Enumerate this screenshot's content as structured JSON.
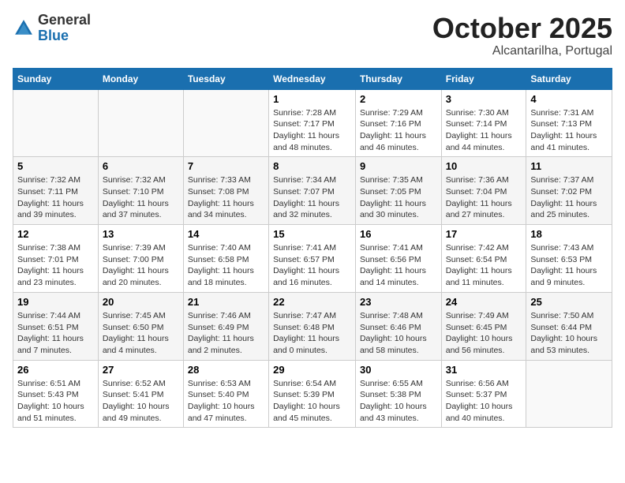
{
  "header": {
    "logo_general": "General",
    "logo_blue": "Blue",
    "month": "October 2025",
    "location": "Alcantarilha, Portugal"
  },
  "weekdays": [
    "Sunday",
    "Monday",
    "Tuesday",
    "Wednesday",
    "Thursday",
    "Friday",
    "Saturday"
  ],
  "weeks": [
    [
      {
        "day": "",
        "info": ""
      },
      {
        "day": "",
        "info": ""
      },
      {
        "day": "",
        "info": ""
      },
      {
        "day": "1",
        "info": "Sunrise: 7:28 AM\nSunset: 7:17 PM\nDaylight: 11 hours\nand 48 minutes."
      },
      {
        "day": "2",
        "info": "Sunrise: 7:29 AM\nSunset: 7:16 PM\nDaylight: 11 hours\nand 46 minutes."
      },
      {
        "day": "3",
        "info": "Sunrise: 7:30 AM\nSunset: 7:14 PM\nDaylight: 11 hours\nand 44 minutes."
      },
      {
        "day": "4",
        "info": "Sunrise: 7:31 AM\nSunset: 7:13 PM\nDaylight: 11 hours\nand 41 minutes."
      }
    ],
    [
      {
        "day": "5",
        "info": "Sunrise: 7:32 AM\nSunset: 7:11 PM\nDaylight: 11 hours\nand 39 minutes."
      },
      {
        "day": "6",
        "info": "Sunrise: 7:32 AM\nSunset: 7:10 PM\nDaylight: 11 hours\nand 37 minutes."
      },
      {
        "day": "7",
        "info": "Sunrise: 7:33 AM\nSunset: 7:08 PM\nDaylight: 11 hours\nand 34 minutes."
      },
      {
        "day": "8",
        "info": "Sunrise: 7:34 AM\nSunset: 7:07 PM\nDaylight: 11 hours\nand 32 minutes."
      },
      {
        "day": "9",
        "info": "Sunrise: 7:35 AM\nSunset: 7:05 PM\nDaylight: 11 hours\nand 30 minutes."
      },
      {
        "day": "10",
        "info": "Sunrise: 7:36 AM\nSunset: 7:04 PM\nDaylight: 11 hours\nand 27 minutes."
      },
      {
        "day": "11",
        "info": "Sunrise: 7:37 AM\nSunset: 7:02 PM\nDaylight: 11 hours\nand 25 minutes."
      }
    ],
    [
      {
        "day": "12",
        "info": "Sunrise: 7:38 AM\nSunset: 7:01 PM\nDaylight: 11 hours\nand 23 minutes."
      },
      {
        "day": "13",
        "info": "Sunrise: 7:39 AM\nSunset: 7:00 PM\nDaylight: 11 hours\nand 20 minutes."
      },
      {
        "day": "14",
        "info": "Sunrise: 7:40 AM\nSunset: 6:58 PM\nDaylight: 11 hours\nand 18 minutes."
      },
      {
        "day": "15",
        "info": "Sunrise: 7:41 AM\nSunset: 6:57 PM\nDaylight: 11 hours\nand 16 minutes."
      },
      {
        "day": "16",
        "info": "Sunrise: 7:41 AM\nSunset: 6:56 PM\nDaylight: 11 hours\nand 14 minutes."
      },
      {
        "day": "17",
        "info": "Sunrise: 7:42 AM\nSunset: 6:54 PM\nDaylight: 11 hours\nand 11 minutes."
      },
      {
        "day": "18",
        "info": "Sunrise: 7:43 AM\nSunset: 6:53 PM\nDaylight: 11 hours\nand 9 minutes."
      }
    ],
    [
      {
        "day": "19",
        "info": "Sunrise: 7:44 AM\nSunset: 6:51 PM\nDaylight: 11 hours\nand 7 minutes."
      },
      {
        "day": "20",
        "info": "Sunrise: 7:45 AM\nSunset: 6:50 PM\nDaylight: 11 hours\nand 4 minutes."
      },
      {
        "day": "21",
        "info": "Sunrise: 7:46 AM\nSunset: 6:49 PM\nDaylight: 11 hours\nand 2 minutes."
      },
      {
        "day": "22",
        "info": "Sunrise: 7:47 AM\nSunset: 6:48 PM\nDaylight: 11 hours\nand 0 minutes."
      },
      {
        "day": "23",
        "info": "Sunrise: 7:48 AM\nSunset: 6:46 PM\nDaylight: 10 hours\nand 58 minutes."
      },
      {
        "day": "24",
        "info": "Sunrise: 7:49 AM\nSunset: 6:45 PM\nDaylight: 10 hours\nand 56 minutes."
      },
      {
        "day": "25",
        "info": "Sunrise: 7:50 AM\nSunset: 6:44 PM\nDaylight: 10 hours\nand 53 minutes."
      }
    ],
    [
      {
        "day": "26",
        "info": "Sunrise: 6:51 AM\nSunset: 5:43 PM\nDaylight: 10 hours\nand 51 minutes."
      },
      {
        "day": "27",
        "info": "Sunrise: 6:52 AM\nSunset: 5:41 PM\nDaylight: 10 hours\nand 49 minutes."
      },
      {
        "day": "28",
        "info": "Sunrise: 6:53 AM\nSunset: 5:40 PM\nDaylight: 10 hours\nand 47 minutes."
      },
      {
        "day": "29",
        "info": "Sunrise: 6:54 AM\nSunset: 5:39 PM\nDaylight: 10 hours\nand 45 minutes."
      },
      {
        "day": "30",
        "info": "Sunrise: 6:55 AM\nSunset: 5:38 PM\nDaylight: 10 hours\nand 43 minutes."
      },
      {
        "day": "31",
        "info": "Sunrise: 6:56 AM\nSunset: 5:37 PM\nDaylight: 10 hours\nand 40 minutes."
      },
      {
        "day": "",
        "info": ""
      }
    ]
  ]
}
